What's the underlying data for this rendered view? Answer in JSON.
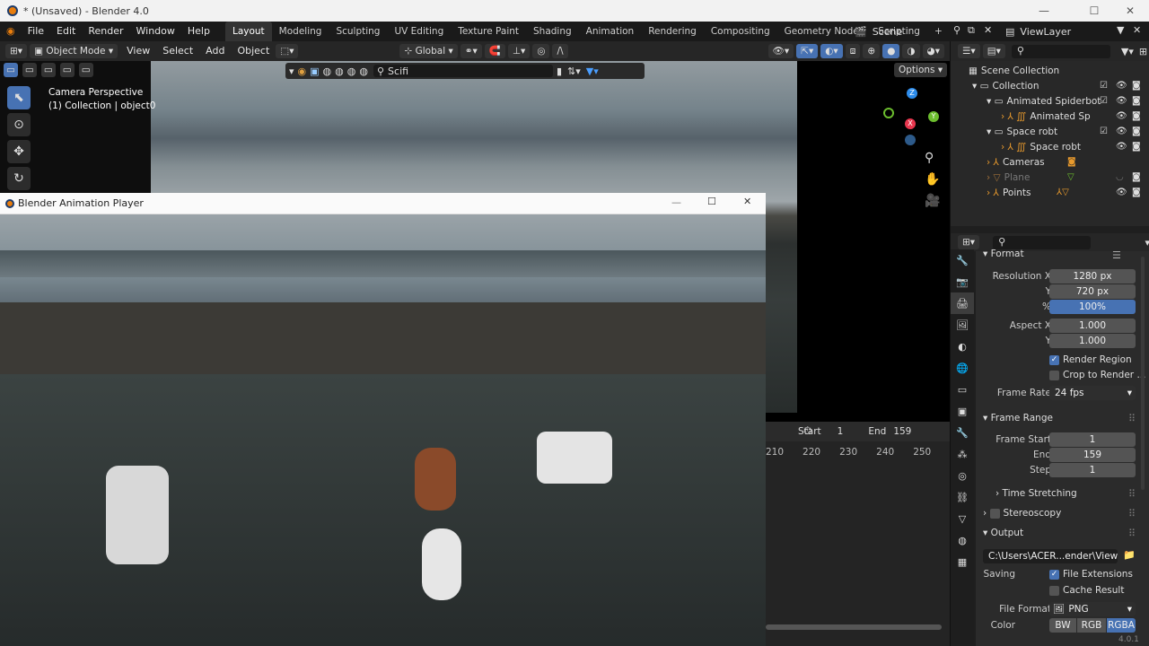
{
  "window": {
    "title": "* (Unsaved) - Blender 4.0"
  },
  "menu": {
    "file": "File",
    "edit": "Edit",
    "render": "Render",
    "window": "Window",
    "help": "Help"
  },
  "workspaces": [
    "Layout",
    "Modeling",
    "Sculpting",
    "UV Editing",
    "Texture Paint",
    "Shading",
    "Animation",
    "Rendering",
    "Compositing",
    "Geometry Nodes",
    "Scripting"
  ],
  "workspace_add": "+",
  "scene": {
    "label": "Scene",
    "view_layer": "ViewLayer"
  },
  "viewport_header": {
    "mode": "Object Mode",
    "view": "View",
    "select": "Select",
    "add": "Add",
    "object": "Object",
    "orientation": "Global",
    "options": "Options"
  },
  "overlay_search": {
    "value": "Scifi"
  },
  "viewport_info": {
    "line1": "Camera Perspective",
    "line2": "(1) Collection | object0"
  },
  "player": {
    "title": "Blender Animation Player"
  },
  "outliner": {
    "root": "Scene Collection",
    "items": [
      {
        "label": "Collection",
        "indent": 1
      },
      {
        "label": "Animated Spiderbot",
        "indent": 2
      },
      {
        "label": "Animated Sp",
        "indent": 3
      },
      {
        "label": "Space robt",
        "indent": 2
      },
      {
        "label": "Space robt",
        "indent": 3
      },
      {
        "label": "Cameras",
        "indent": 2
      },
      {
        "label": "Plane",
        "indent": 2
      },
      {
        "label": "Points",
        "indent": 2
      }
    ]
  },
  "timeline": {
    "start_label": "Start",
    "start": "1",
    "end_label": "End",
    "end": "159",
    "ticks": [
      "210",
      "220",
      "230",
      "240",
      "250"
    ]
  },
  "properties": {
    "format_header": "Format",
    "resolution_x_label": "Resolution X",
    "resolution_x": "1280 px",
    "y_label": "Y",
    "resolution_y": "720 px",
    "percent_label": "%",
    "percent": "100%",
    "aspect_x_label": "Aspect X",
    "aspect_x": "1.000",
    "aspect_y_label": "Y",
    "aspect_y": "1.000",
    "render_region": "Render Region",
    "crop": "Crop to Render ...",
    "frame_rate_label": "Frame Rate",
    "frame_rate": "24 fps",
    "frame_range_header": "Frame Range",
    "frame_start_label": "Frame Start",
    "frame_start": "1",
    "end_label": "End",
    "frame_end": "159",
    "step_label": "Step",
    "step": "1",
    "time_stretching": "Time Stretching",
    "stereoscopy": "Stereoscopy",
    "output_header": "Output",
    "output_path": "C:\\Users\\ACER...ender\\Viewport\\",
    "saving_label": "Saving",
    "file_extensions": "File Extensions",
    "cache_result": "Cache Result",
    "file_format_label": "File Format",
    "file_format": "PNG",
    "color_label": "Color",
    "color_bw": "BW",
    "color_rgb": "RGB",
    "color_rgba": "RGBA"
  },
  "version": "4.0.1",
  "colors": {
    "accent": "#4772b3",
    "active_ws": "#333333",
    "blender_orange": "#e87d0d"
  }
}
